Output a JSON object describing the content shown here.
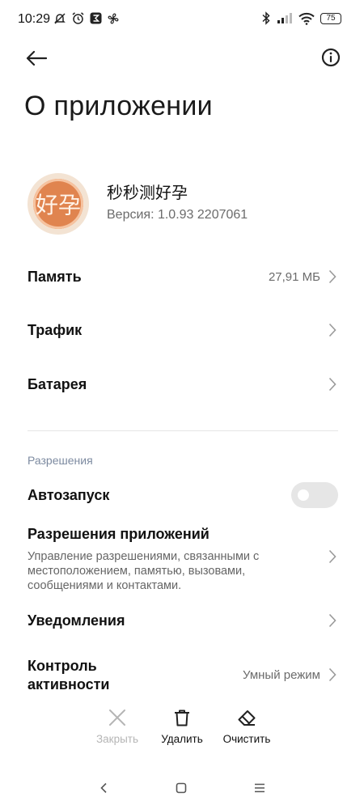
{
  "status_bar": {
    "time": "10:29",
    "battery": "75",
    "left_icons": [
      "mute-icon",
      "alarm-icon",
      "notification-icon",
      "fan-icon"
    ],
    "right_icons": [
      "bluetooth-icon",
      "signal-icon",
      "wifi-icon",
      "battery-icon"
    ]
  },
  "header": {
    "title": "О приложении"
  },
  "app": {
    "name": "秒秒测好孕",
    "version": "Версия: 1.0.93 2207061",
    "icon_glyph": "好孕"
  },
  "rows": {
    "memory": {
      "label": "Память",
      "value": "27,91 МБ"
    },
    "traffic": {
      "label": "Трафик"
    },
    "battery": {
      "label": "Батарея"
    }
  },
  "permissions": {
    "section_title": "Разрешения",
    "autostart": {
      "label": "Автозапуск",
      "enabled": false
    },
    "app_permissions": {
      "label": "Разрешения приложений",
      "description": "Управление разрешениями, связанными с местоположением, памятью, вызовами, сообщениями и контактами."
    },
    "notifications": {
      "label": "Уведомления"
    },
    "activity_control": {
      "label": "Контроль активности",
      "value": "Умный режим"
    }
  },
  "actions": {
    "close": "Закрыть",
    "delete": "Удалить",
    "clear": "Очистить"
  },
  "colors": {
    "accent_muted": "#7c8aa0",
    "app_icon": "#e0844f",
    "disabled": "#b5b5b5"
  }
}
